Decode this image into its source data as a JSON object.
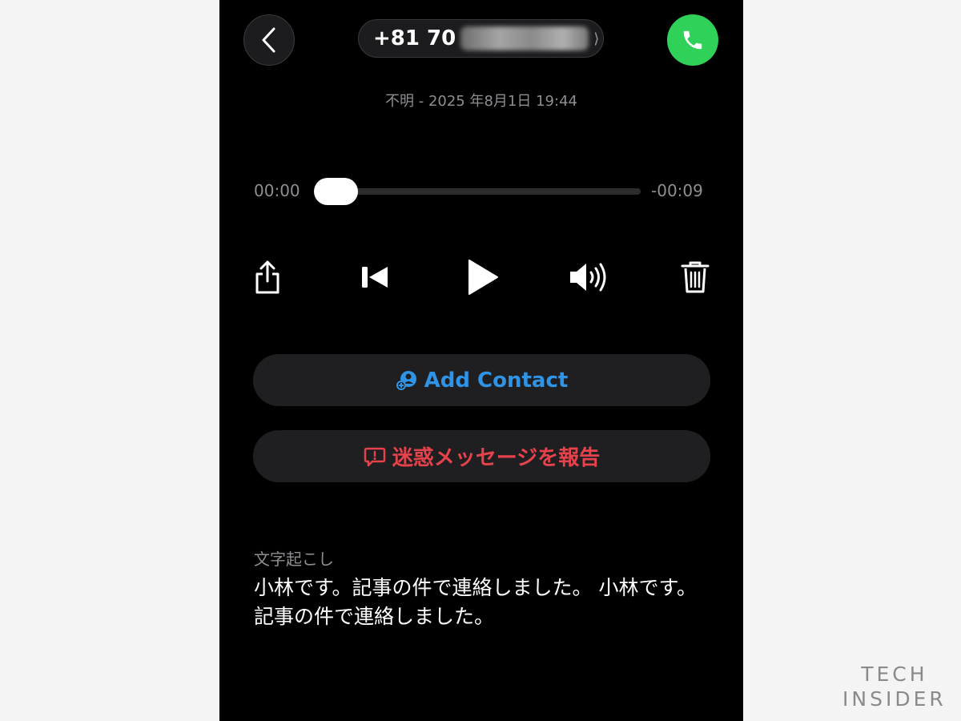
{
  "header": {
    "phone_number": "+81 70",
    "subtitle": "不明 - 2025 年8月1日 19:44"
  },
  "player": {
    "elapsed": "00:00",
    "remaining": "-00:09",
    "progress": 0
  },
  "controls": {
    "icons": [
      "share-icon",
      "skip-back-icon",
      "play-icon",
      "speaker-icon",
      "trash-icon"
    ]
  },
  "actions": {
    "add_contact_label": "Add Contact",
    "report_label": "迷惑メッセージを報告"
  },
  "transcript": {
    "label": "文字起こし",
    "text": "小林です。記事の件で連絡しました。 小林です。記事の件で連絡しました。"
  },
  "watermark": {
    "line1": "TECH",
    "line2": "INSIDER"
  },
  "colors": {
    "background": "#000000",
    "call_green": "#30d158",
    "link_blue": "#2f93e6",
    "destructive_red": "#e5424c",
    "secondary_text": "#8e8e93"
  }
}
